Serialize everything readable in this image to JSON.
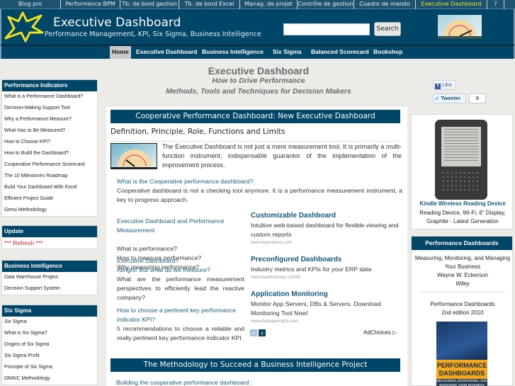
{
  "topbar": {
    "links": [
      {
        "label": "Blog pro",
        "active": false
      },
      {
        "label": "Performance BPM",
        "active": false
      },
      {
        "label": "Tb. de bord gestion",
        "active": false
      },
      {
        "label": "Tb. de bord Excel",
        "active": false
      },
      {
        "label": "Manag. de projet",
        "active": false
      },
      {
        "label": "Contrôle de gestion",
        "active": false
      },
      {
        "label": "Cuadro de mando",
        "active": false
      },
      {
        "label": "Executive Dashboard",
        "active": true
      },
      {
        "label": "?",
        "active": false
      }
    ]
  },
  "header": {
    "logo_icon": "star-burst-icon",
    "title": "Executive Dashboard",
    "subtitle": "Performance Management, KPI, Six Sigma, Business Intelligence",
    "search_value": "",
    "search_button": "Search",
    "gauge_icon": "gauge-icon"
  },
  "nav": {
    "items": [
      {
        "label": "Home",
        "active": true
      },
      {
        "label": "Executive Dashboard",
        "active": false
      },
      {
        "label": "Business Intelligence",
        "active": false
      },
      {
        "label": "Six Sigma",
        "active": false
      },
      {
        "label": "Balanced Scorecard",
        "active": false
      },
      {
        "label": "Bookshop",
        "active": false
      }
    ]
  },
  "sidebar": {
    "performance": {
      "title": "Performance Indicators",
      "items": [
        "What is a Performance Dashboard?",
        "Decision-Making Support Tool",
        "Why a Performance Measure?",
        "What Has to Be Measured?",
        "How to Choose KPI?",
        "How to Build the Dashboard?",
        "Cooperative Performance Scorecard",
        "The 10 Milestones Roadmap",
        "Build Your Dashboard With Excel",
        "Efficient Project Guide",
        "Gimsi Methodology"
      ]
    },
    "update": {
      "title": "Update",
      "items": [
        "*** Refresh ***"
      ]
    },
    "bi": {
      "title": "Business Intelligence",
      "items": [
        "Data Warehouse Project",
        "Decision Support System"
      ]
    },
    "sixsigma": {
      "title": "Six Sigma",
      "items": [
        "Six Sigma",
        "What is Six Sigma?",
        "Origins of Six Sigma",
        "Six Sigma Profit",
        "Principle of Six Sigma",
        "DMAIC Methodology"
      ]
    }
  },
  "hero": {
    "title": "Executive Dashboard",
    "tagline1": "How to Drive Performance",
    "tagline2": "Methods, Tools and Techniques for Decision Makers"
  },
  "main": {
    "section1_title": "Cooperative Performance Dashboard: New Executive Dashboard",
    "definition": "Definition, Principle, Role, Functions and Limits",
    "intro": "The Executive Dashboard is not just a mere measurement tool. It is primarily a multi-function instrument, indispensable guarantor of the implementation of the improvement process.",
    "block1": {
      "link": "What is the Cooperative performance dashboard?",
      "text": "Cooperative dashboard is not a checking tool anymore. It is a performance measurement instrument, a key to progress approach."
    },
    "block2": {
      "link": "Executive Dashboard and Performance Measurement",
      "text": "What is performance?\nHow to measure performance?\nWhy measuring performance?"
    },
    "block3": {
      "link1": "Executive Dashboard?",
      "link2": "Allright! But what do we measure?",
      "text": "What are the performance measurement perspectives to efficiently lead the reactive company?"
    },
    "block4": {
      "link": "How to choose a pertinent key performance indicator KPI?",
      "text": "5 recommendations to choose a reliable and really pertinent key performance indicator KPI."
    },
    "ads": [
      {
        "title": "Customizable Dashboard",
        "desc": "Intuitive web-based dashboard for flexible viewing and custom reports",
        "url": "www.itoperations.com"
      },
      {
        "title": "Preconfigured Dashboards",
        "desc": "Industry metrics and KPIs for your ERP data",
        "url": "www.bluemarlinsys.com/bi"
      },
      {
        "title": "Application Monitoring",
        "desc": "Monitor App Servers, DBs & Servers. Download Monitoring Tool Now!",
        "url": "www.manageengine.com"
      }
    ],
    "ad_prev": "‹",
    "ad_next": "›",
    "adchoices": "AdChoices ▷",
    "section2_title": "The Methodology to Succeed a Business Intelligence Project",
    "section2_link": "Building the cooperative performance dashboard :"
  },
  "right": {
    "fb_like": "Like",
    "tweet": "Tweeter",
    "tweet_count": "0",
    "kindle": {
      "title": "Kindle Wireless Reading Device",
      "desc": "Reading Device, Wi-Fi, 6\" Display, Graphite - Latest Generation"
    },
    "book_box": {
      "title": "Performance Dashboards",
      "desc1": "Measuring, Monitoring, and Managing Your Business",
      "author": "Wayne W. Eckerson",
      "publisher": "Wiley",
      "book_title": "Performance Dashboards",
      "edition": "2nd edition 2010",
      "cover_title": "PERFORMANCE DASHBOARDS",
      "cover_sub": "MEASURING, MONITORING, AND MANAGING YOUR BUSINESS"
    }
  },
  "colors": {
    "brand": "#004668",
    "link": "#1a5d86",
    "active_top": "#e1e836",
    "refresh": "#e02020"
  }
}
